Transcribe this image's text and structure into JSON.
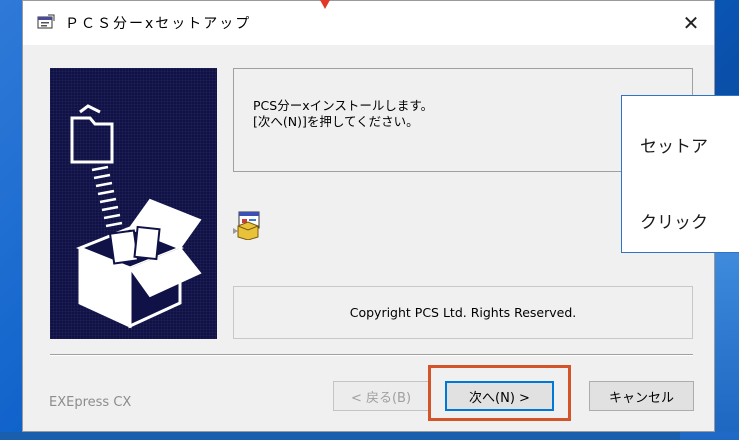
{
  "window": {
    "title": "ＰＣＳ分ーxセットアップ",
    "close_label": "✕"
  },
  "message": {
    "line1": "PCS分ーxインストールします。",
    "line2": "[次へ(N)]を押してください。"
  },
  "copyright": "Copyright PCS Ltd. Rights Reserved.",
  "brand": "EXEpress CX",
  "buttons": {
    "back": "< 戻る(B)",
    "next": "次へ(N) >",
    "cancel": "キャンセル"
  },
  "callout": {
    "line1": "セットア",
    "line2": "クリック"
  },
  "colors": {
    "highlight": "#d35428",
    "art_background": "#0f1147",
    "callout_border": "#2f74c4"
  },
  "icons": [
    "setup-app-icon",
    "setup-installer-icon",
    "close-icon"
  ]
}
